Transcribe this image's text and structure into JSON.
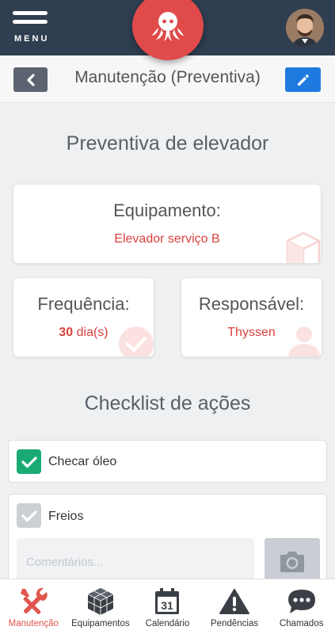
{
  "header": {
    "menu_label": "MENU"
  },
  "subheader": {
    "title": "Manutenção (Preventiva)"
  },
  "main": {
    "title": "Preventiva de elevador",
    "equipment": {
      "label": "Equipamento:",
      "value": "Elevador serviço B"
    },
    "frequency": {
      "label": "Frequência:",
      "number": "30",
      "unit": " dia(s)"
    },
    "responsible": {
      "label": "Responsável:",
      "value": "Thyssen"
    },
    "checklist_title": "Checklist de ações",
    "checklist": [
      {
        "label": "Checar óleo",
        "checked": true
      },
      {
        "label": "Freios",
        "checked": false,
        "comments_placeholder": "Comentários..."
      }
    ]
  },
  "nav": {
    "items": [
      {
        "label": "Manutenção",
        "icon": "tools-icon",
        "active": true
      },
      {
        "label": "Equipamentos",
        "icon": "cube-icon",
        "active": false
      },
      {
        "label": "Calendário",
        "icon": "calendar-icon",
        "day": "31",
        "active": false
      },
      {
        "label": "Pendências",
        "icon": "warning-icon",
        "active": false
      },
      {
        "label": "Chamados",
        "icon": "chat-icon",
        "active": false
      }
    ]
  },
  "colors": {
    "topbar": "#2f3e50",
    "accent_red": "#e04a4a",
    "edit_blue": "#1f7ae0",
    "checked_green": "#1aab73"
  }
}
